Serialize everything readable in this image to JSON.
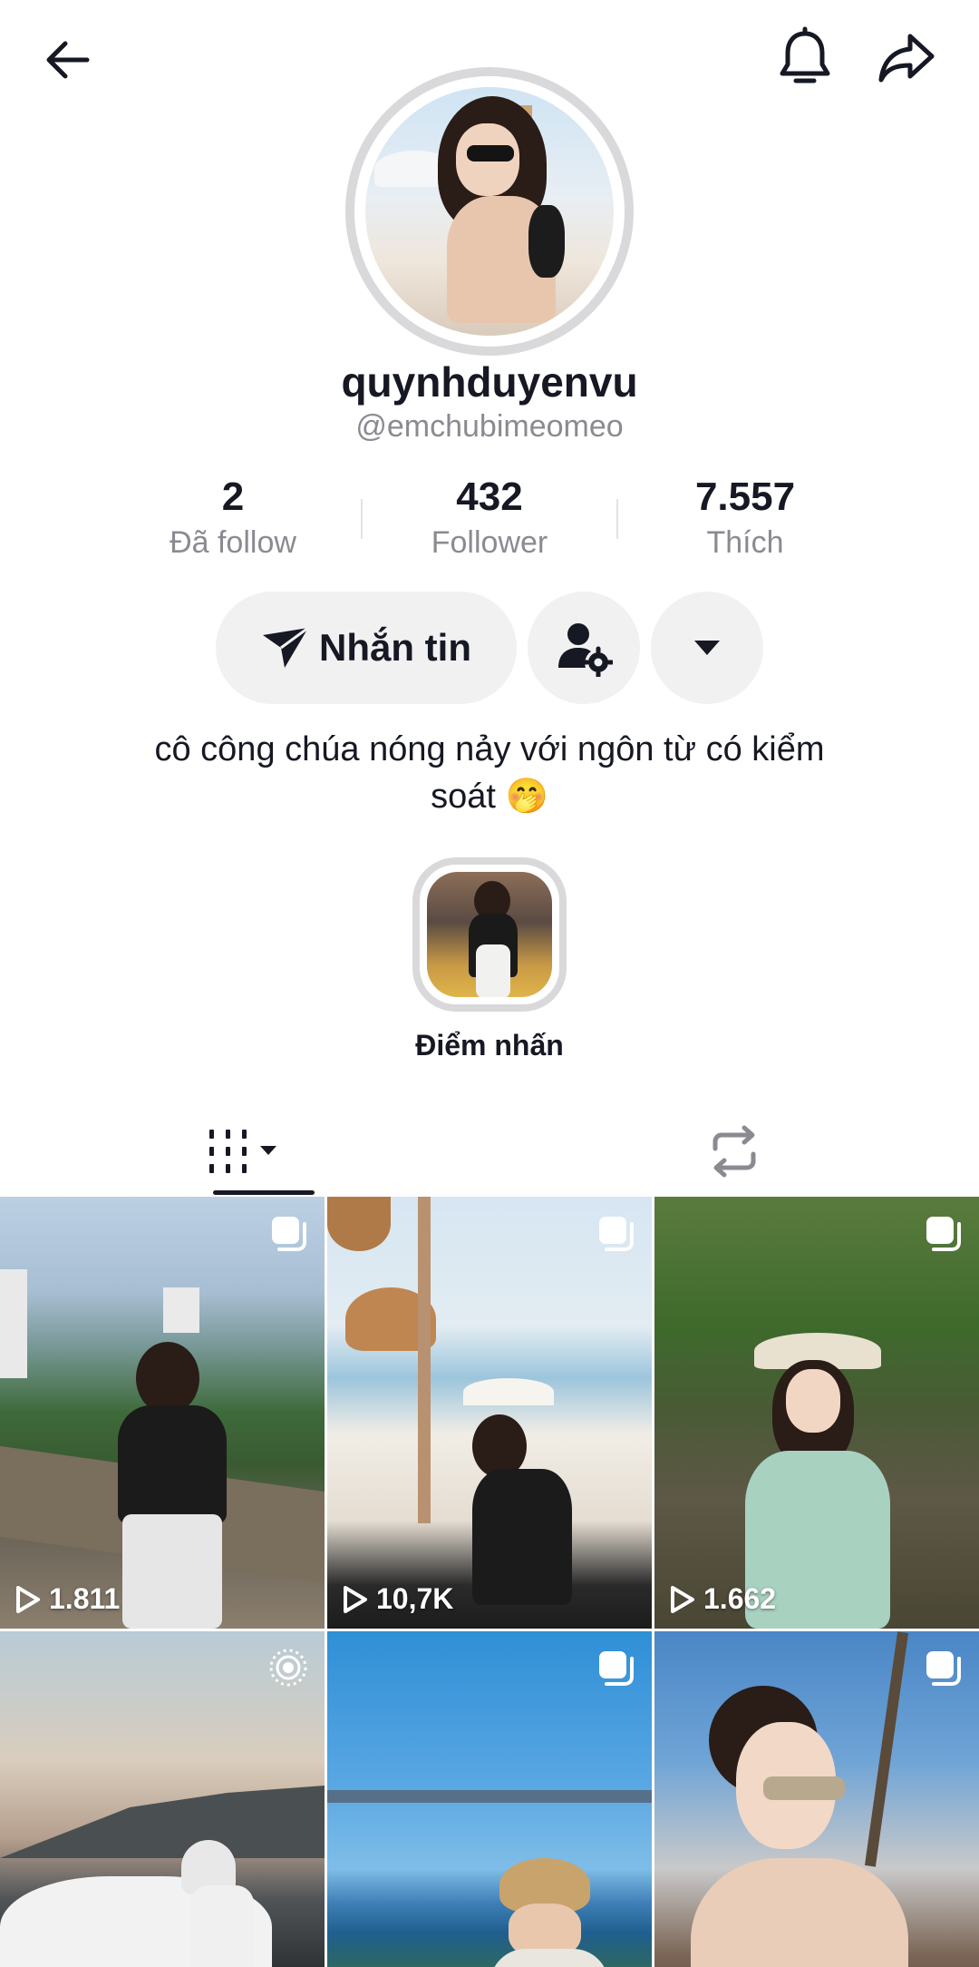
{
  "profile": {
    "username": "quynhduyenvu",
    "handle": "@emchubimeomeo",
    "bio_line1": "cô công chúa nóng nảy với ngôn từ có kiểm",
    "bio_line2": "soát 🤭"
  },
  "stats": [
    {
      "value": "2",
      "label": "Đã follow"
    },
    {
      "value": "432",
      "label": "Follower"
    },
    {
      "value": "7.557",
      "label": "Thích"
    }
  ],
  "actions": {
    "message_label": "Nhắn tin"
  },
  "highlight": {
    "label": "Điểm nhấn"
  },
  "icons": {
    "back": "back-arrow-icon",
    "bell": "bell-icon",
    "share": "share-icon",
    "send": "send-icon",
    "friend_settings": "user-settings-icon",
    "dropdown": "chevron-down-icon",
    "grid_tab": "grid-icon",
    "repost_tab": "repost-icon"
  },
  "videos": [
    {
      "views": "1.811",
      "badge": "multi-photo"
    },
    {
      "views": "10,7K",
      "badge": "multi-photo"
    },
    {
      "views": "1.662",
      "badge": "multi-photo"
    },
    {
      "views": "",
      "badge": "live-photo"
    },
    {
      "views": "",
      "badge": "multi-photo"
    },
    {
      "views": "",
      "badge": "multi-photo"
    }
  ],
  "colors": {
    "text": "#161823",
    "secondary": "#8a8b91",
    "button_bg": "#f1f1f2"
  }
}
